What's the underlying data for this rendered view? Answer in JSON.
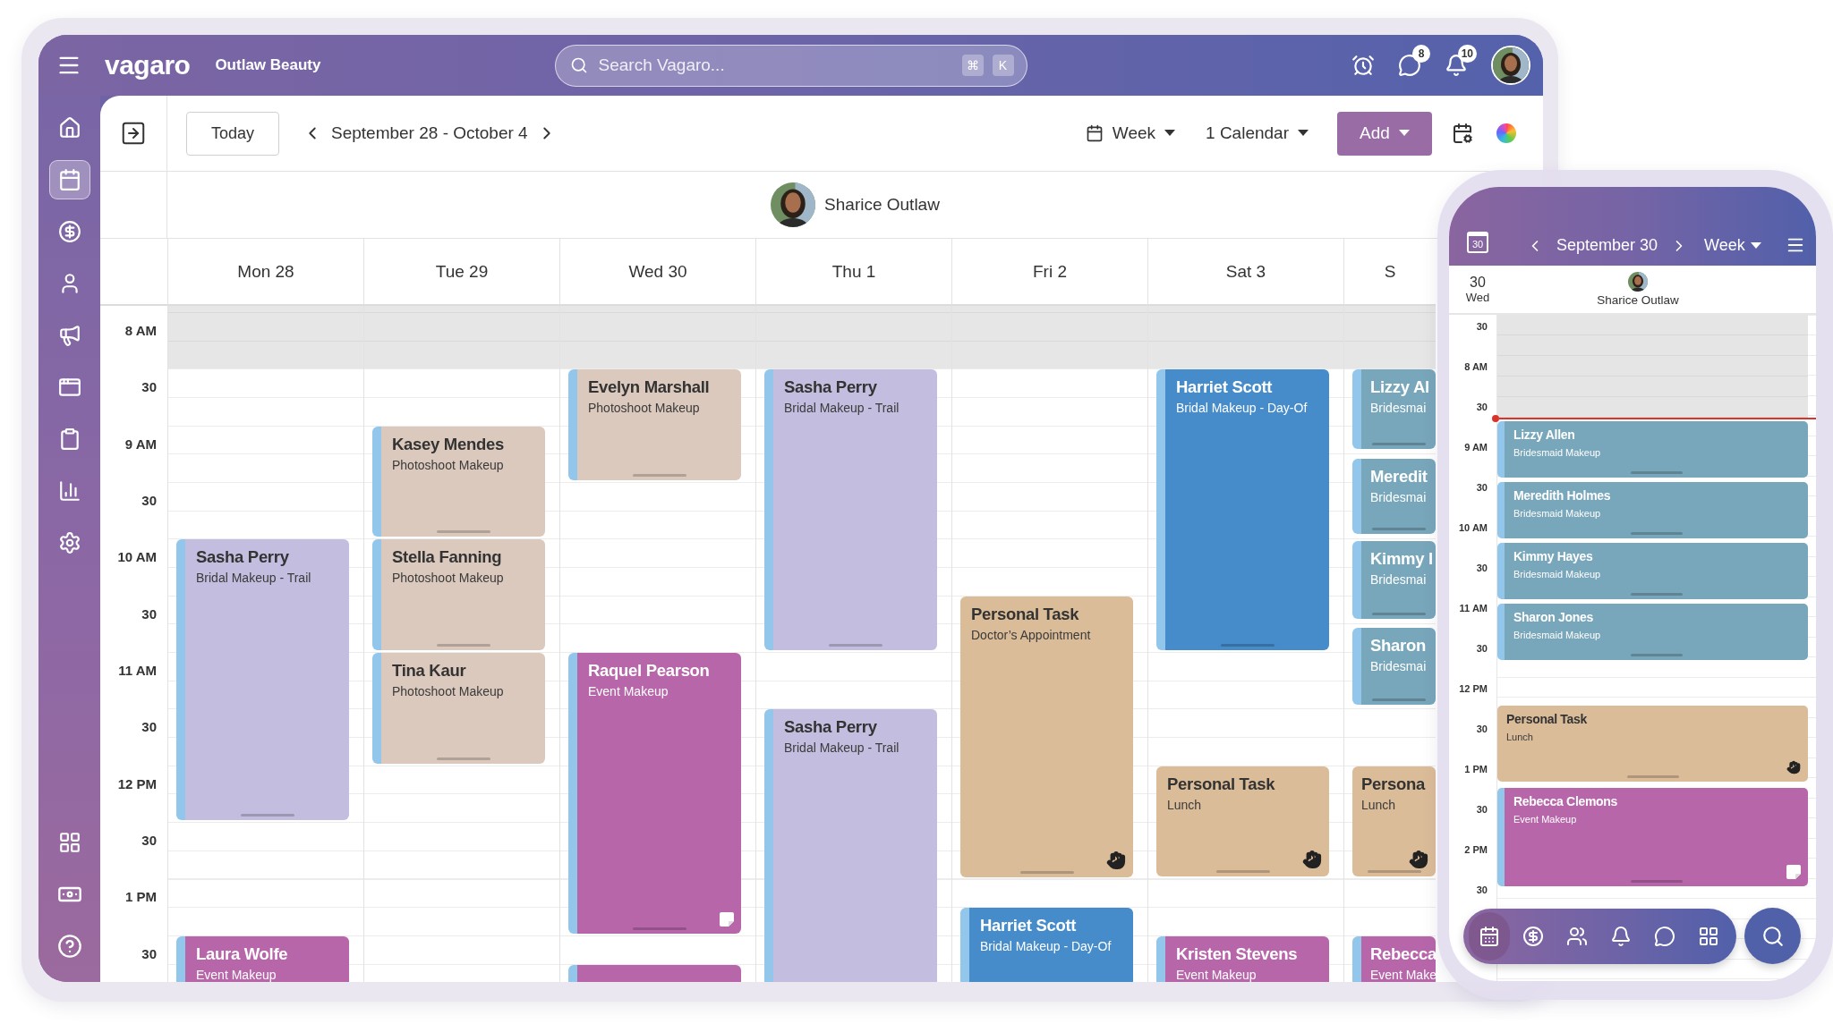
{
  "topbar": {
    "logo": "vagaro",
    "business": "Outlaw Beauty",
    "search": {
      "placeholder": "Search Vagaro...",
      "keys": [
        "⌘",
        "K"
      ]
    },
    "icons": [
      {
        "kind": "alarm"
      },
      {
        "kind": "messages",
        "badge": "8"
      },
      {
        "kind": "notifications",
        "badge": "10"
      },
      {
        "kind": "avatar"
      }
    ]
  },
  "sidebar": {
    "items": [
      {
        "selected": false
      },
      {
        "selected": true
      },
      {
        "selected": false
      },
      {
        "selected": false
      },
      {
        "selected": false
      },
      {
        "selected": false
      },
      {
        "selected": false
      },
      {
        "selected": false
      },
      {
        "selected": false
      }
    ]
  },
  "toolbar": {
    "today": "Today",
    "range": "September 28 - October 4",
    "view": "Week",
    "calendars": "1 Calendar",
    "add": "Add"
  },
  "calendar": {
    "staff": "Sharice Outlaw",
    "times": [
      "8 AM",
      "30",
      "9 AM",
      "30",
      "10 AM",
      "30",
      "11 AM",
      "30",
      "12 PM",
      "30",
      "1 PM",
      "30"
    ],
    "days": [
      {
        "label": "Mon 28",
        "events": [
          {
            "kind": "appointment",
            "name": "Sasha Perry",
            "service": "Bridal Makeup - Trail",
            "color": "#c3bedf"
          },
          {
            "kind": "appointment",
            "name": "Laura Wolfe",
            "service": "Event Makeup",
            "color": "#b766aa"
          }
        ]
      },
      {
        "label": "Tue 29",
        "events": [
          {
            "kind": "appointment",
            "name": "Kasey Mendes",
            "service": "Photoshoot Makeup",
            "color": "#dcc9bd"
          },
          {
            "kind": "appointment",
            "name": "Stella Fanning",
            "service": "Photoshoot Makeup",
            "color": "#dcc9bd"
          },
          {
            "kind": "appointment",
            "name": "Tina Kaur",
            "service": "Photoshoot Makeup",
            "color": "#dcc9bd"
          }
        ]
      },
      {
        "label": "Wed 30",
        "events": [
          {
            "kind": "appointment",
            "name": "Evelyn Marshall",
            "service": "Photoshoot Makeup",
            "color": "#dcc9bd"
          },
          {
            "kind": "appointment",
            "name": "Raquel Pearson",
            "service": "Event Makeup",
            "color": "#b766aa",
            "note": true
          },
          {
            "kind": "appointment",
            "color": "#b766aa"
          }
        ]
      },
      {
        "label": "Thu 1",
        "events": [
          {
            "kind": "appointment",
            "name": "Sasha Perry",
            "service": "Bridal Makeup - Trail",
            "color": "#c3bedf"
          },
          {
            "kind": "appointment",
            "name": "Sasha Perry",
            "service": "Bridal Makeup - Trail",
            "color": "#c3bedf"
          }
        ]
      },
      {
        "label": "Fri 2",
        "events": [
          {
            "kind": "task",
            "name": "Personal Task",
            "service": "Doctor’s Appointment",
            "color": "#dbbc99"
          },
          {
            "kind": "appointment",
            "name": "Harriet Scott",
            "service": "Bridal Makeup - Day-Of",
            "color": "#468bca"
          }
        ]
      },
      {
        "label": "Sat 3",
        "events": [
          {
            "kind": "appointment",
            "name": "Harriet Scott",
            "service": "Bridal Makeup - Day-Of",
            "color": "#468bca"
          },
          {
            "kind": "task",
            "name": "Personal Task",
            "service": "Lunch",
            "color": "#dbbc99"
          },
          {
            "kind": "appointment",
            "name": "Kristen Stevens",
            "service": "Event Makeup",
            "color": "#b766aa"
          }
        ]
      },
      {
        "label": "S",
        "events": [
          {
            "kind": "appointment",
            "name": "Lizzy Al",
            "service": "Bridesmai",
            "color": "#78a6ba"
          },
          {
            "kind": "appointment",
            "name": "Meredit",
            "service": "Bridesmai",
            "color": "#78a6ba"
          },
          {
            "kind": "appointment",
            "name": "Kimmy I",
            "service": "Bridesmai",
            "color": "#78a6ba"
          },
          {
            "kind": "appointment",
            "name": "Sharon",
            "service": "Bridesmai",
            "color": "#78a6ba"
          },
          {
            "kind": "task",
            "name": "Persona",
            "service": "Lunch",
            "color": "#dbbc99"
          },
          {
            "kind": "appointment",
            "name": "Rebecca",
            "service": "Event Make",
            "color": "#b766aa"
          }
        ]
      }
    ]
  },
  "phone": {
    "calendar_day": "30",
    "date": "September 30",
    "view": "Week",
    "day_number": "30",
    "weekday": "Wed",
    "staff": "Sharice Outlaw",
    "times": [
      "30",
      "8 AM",
      "30",
      "9 AM",
      "30",
      "10 AM",
      "30",
      "11 AM",
      "30",
      "12 PM",
      "30",
      "1 PM",
      "30",
      "2 PM",
      "30"
    ],
    "events": [
      {
        "kind": "appointment",
        "name": "Lizzy Allen",
        "service": "Bridesmaid Makeup",
        "color": "#78a6ba"
      },
      {
        "kind": "appointment",
        "name": "Meredith Holmes",
        "service": "Bridesmaid Makeup",
        "color": "#78a6ba"
      },
      {
        "kind": "appointment",
        "name": "Kimmy Hayes",
        "service": "Bridesmaid Makeup",
        "color": "#78a6ba"
      },
      {
        "kind": "appointment",
        "name": "Sharon Jones",
        "service": "Bridesmaid Makeup",
        "color": "#78a6ba"
      },
      {
        "kind": "task",
        "name": "Personal Task",
        "service": "Lunch",
        "color": "#dbbc99"
      },
      {
        "kind": "appointment",
        "name": "Rebecca Clemons",
        "service": "Event Makeup",
        "color": "#b766aa",
        "note": true
      }
    ],
    "nav": [
      {
        "selected": true
      },
      {
        "selected": false
      },
      {
        "selected": false
      },
      {
        "selected": false
      },
      {
        "selected": false
      },
      {
        "selected": false
      }
    ]
  }
}
